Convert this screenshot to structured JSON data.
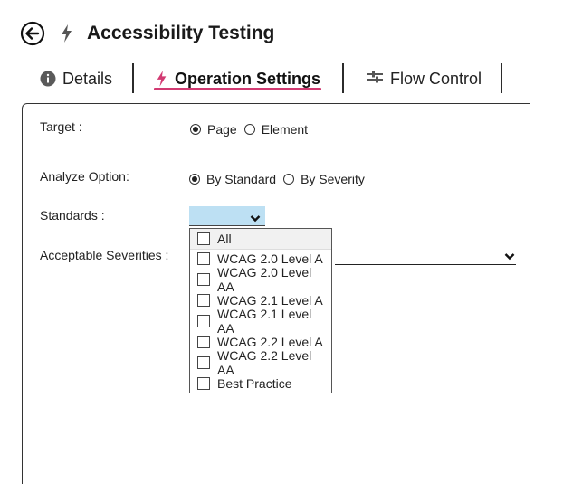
{
  "header": {
    "title": "Accessibility Testing"
  },
  "tabs": {
    "details": "Details",
    "operation": "Operation Settings",
    "flow": "Flow Control"
  },
  "form": {
    "target": {
      "label": "Target :",
      "options": [
        "Page",
        "Element"
      ],
      "selected": "Page"
    },
    "analyze": {
      "label": "Analyze Option:",
      "options": [
        "By Standard",
        "By Severity"
      ],
      "selected": "By Standard"
    },
    "standards": {
      "label": "Standards :"
    },
    "severities": {
      "label": "Acceptable Severities :"
    }
  },
  "standards_dropdown": {
    "items": [
      "All",
      "WCAG 2.0 Level A",
      "WCAG 2.0 Level AA",
      "WCAG 2.1 Level A",
      "WCAG 2.1 Level AA",
      "WCAG 2.2 Level A",
      "WCAG 2.2 Level AA",
      "Best Practice"
    ]
  },
  "colors": {
    "accent": "#d23a72",
    "select_bg": "#bde0f3"
  }
}
